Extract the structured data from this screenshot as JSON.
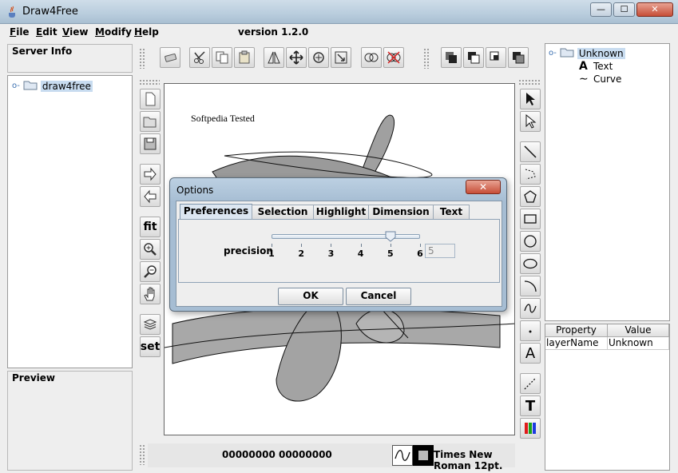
{
  "window": {
    "title": "Draw4Free",
    "controls": {
      "minimize": "—",
      "maximize": "☐",
      "close": "✕"
    }
  },
  "menu": {
    "items": [
      {
        "label": "File",
        "u": "F",
        "rest": "ile"
      },
      {
        "label": "Edit",
        "u": "E",
        "rest": "dit"
      },
      {
        "label": "View",
        "u": "V",
        "rest": "iew"
      },
      {
        "label": "Modify",
        "u": "M",
        "rest": "odify"
      },
      {
        "label": "Help",
        "u": "H",
        "rest": "elp"
      }
    ],
    "version": "version 1.2.0"
  },
  "server_info": {
    "title": "Server Info"
  },
  "server_tree": {
    "root": "draw4free"
  },
  "preview": {
    "title": "Preview"
  },
  "left_tools": {
    "fit": "fit",
    "set": "set"
  },
  "canvas": {
    "watermark_text": "Softpedia Tested"
  },
  "layers_tree": {
    "root": "Unknown",
    "children": [
      {
        "label": "Text",
        "icon": "A"
      },
      {
        "label": "Curve",
        "icon": "∼"
      }
    ]
  },
  "properties": {
    "headers": [
      "Property",
      "Value"
    ],
    "rows": [
      {
        "property": "layerName",
        "value": "Unknown"
      }
    ]
  },
  "status": {
    "coords": "00000000  00000000",
    "font": "Times New Roman 12pt."
  },
  "right_tools": {
    "text_tool": "A",
    "text_tool2": "T"
  },
  "dialog": {
    "title": "Options",
    "tabs": [
      "Preferences",
      "Selection",
      "Highlight",
      "Dimension",
      "Text"
    ],
    "active_tab": "Preferences",
    "precision_label": "precision",
    "slider": {
      "min": 1,
      "max": 6,
      "value": 5,
      "ticks": [
        "1",
        "2",
        "3",
        "4",
        "5",
        "6"
      ]
    },
    "precision_value": "5",
    "ok": "OK",
    "cancel": "Cancel"
  }
}
